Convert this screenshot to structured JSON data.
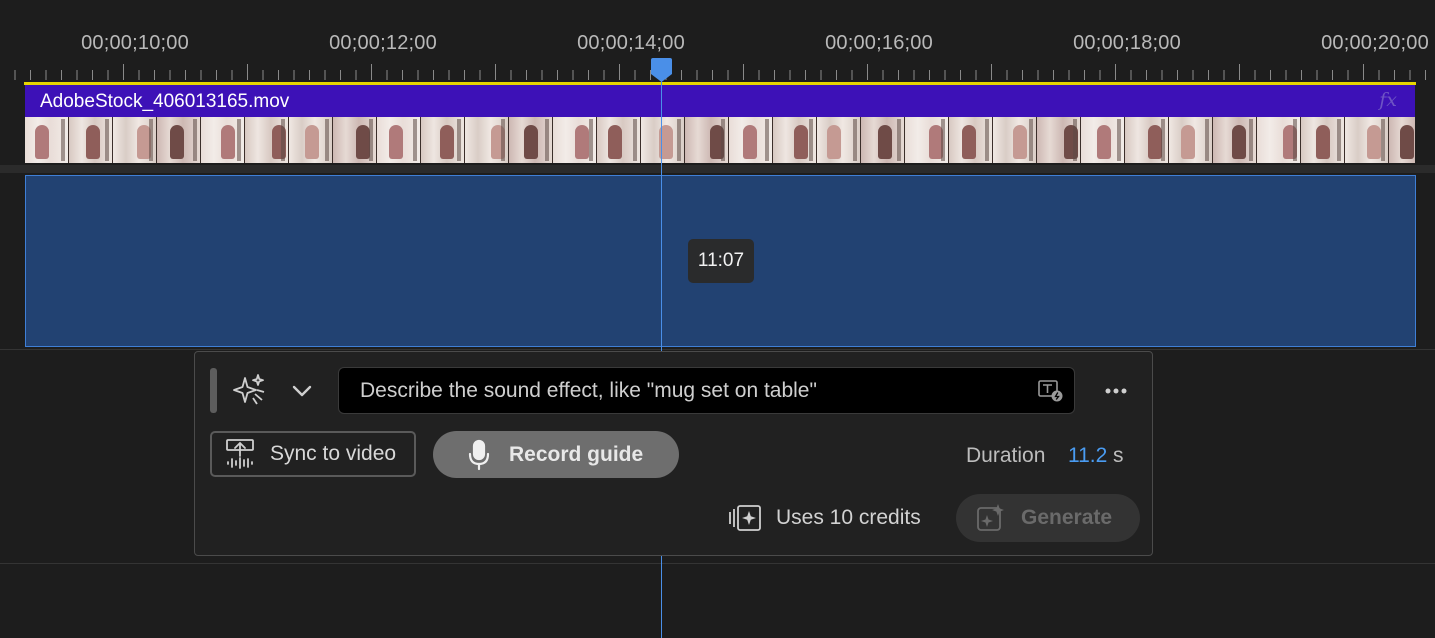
{
  "timeline": {
    "ruler_labels": [
      "00;00;10;00",
      "00;00;12;00",
      "00;00;14;00",
      "00;00;16;00",
      "00;00;18;00",
      "00;00;20;00"
    ],
    "video_clip": {
      "name": "AdobeStock_406013165.mov",
      "fx_badge": "fx"
    },
    "audio_placeholder": {
      "duration_tooltip": "11:07"
    },
    "playhead_icon": "playhead-marker-icon"
  },
  "sound_effect_panel": {
    "prompt": {
      "placeholder": "Describe the sound effect, like \"mug set on table\"",
      "value": "",
      "icon": "text-to-sound-icon"
    },
    "mode_icon": "sparkle-icon",
    "sync_button": {
      "label": "Sync to video",
      "icon": "sync-waveform-icon"
    },
    "record_button": {
      "label": "Record guide",
      "icon": "microphone-icon"
    },
    "duration": {
      "label": "Duration",
      "value": "11.2",
      "unit": "s"
    },
    "credits": {
      "label": "Uses 10 credits",
      "icon": "credits-icon"
    },
    "generate_button": {
      "label": "Generate",
      "icon": "generate-sparkle-icon",
      "enabled": false
    }
  },
  "colors": {
    "video_clip": "#3d11b7",
    "audio_region": "#224272",
    "accent_blue": "#4a9cf2",
    "work_area": "#e6d500"
  }
}
